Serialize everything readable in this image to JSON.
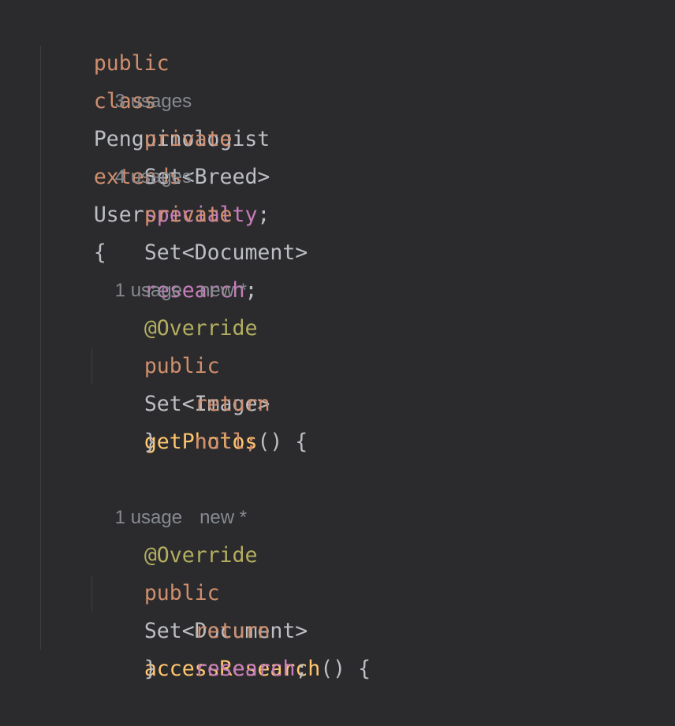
{
  "code": {
    "class_decl": {
      "public": "public",
      "class": "class",
      "name": "Penguinologist",
      "extends": "extends",
      "parent": "User",
      "brace": "{"
    },
    "field1": {
      "hint": "3 usages",
      "modifier": "private",
      "type": "Set<Breed>",
      "name": "specialty",
      "semi": ";"
    },
    "field2": {
      "hint": "4 usages",
      "modifier": "private",
      "type": "Set<Document>",
      "name": "research",
      "semi": ";"
    },
    "method1": {
      "hint_usage": "1 usage",
      "hint_new": "new *",
      "annotation": "@Override",
      "modifier": "public",
      "type": "Set<Image>",
      "name": "getPhotos",
      "signature_rest": "() {",
      "return_kw": "return",
      "return_val": "null;",
      "close": "}"
    },
    "method2": {
      "hint_usage": "1 usage",
      "hint_new": "new *",
      "annotation": "@Override",
      "modifier": "public",
      "type": "Set<Document>",
      "name": "accessResearch",
      "signature_rest": "() {",
      "return_kw": "return",
      "return_val": "research",
      "return_semi": ";",
      "close": "}"
    }
  },
  "colors": {
    "background": "#2b2b2d",
    "keyword": "#cf8e6d",
    "field": "#c77dbb",
    "method_declaration": "#ffc66d",
    "annotation": "#b3ae60",
    "text": "#bcbec4",
    "hint": "#868a91"
  }
}
